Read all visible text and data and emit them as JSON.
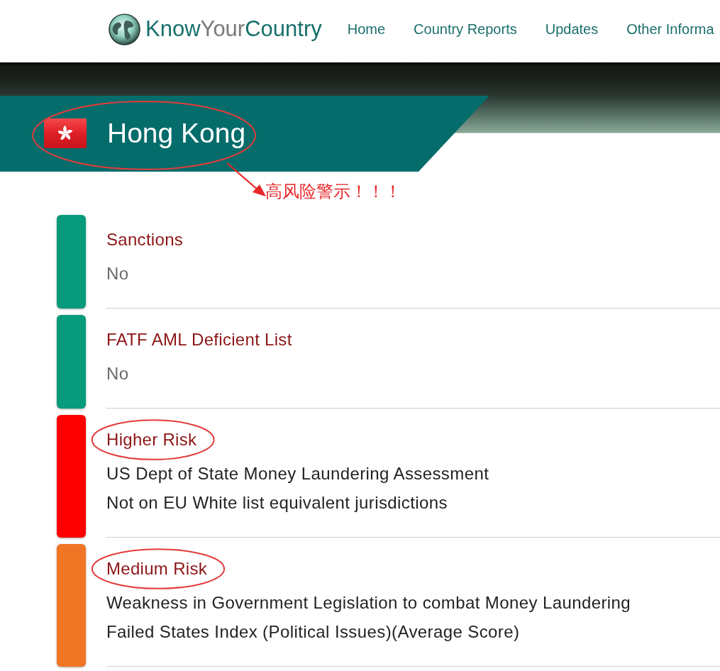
{
  "header": {
    "logo": [
      {
        "text": "Know",
        "kind": "brand"
      },
      {
        "text": "Your",
        "kind": "muted"
      },
      {
        "text": "Country",
        "kind": "brand"
      }
    ],
    "nav": [
      "Home",
      "Country Reports",
      "Updates",
      "Other Informa"
    ]
  },
  "banner": {
    "title": "Hong Kong",
    "circled": true
  },
  "callout": {
    "text": "高风险警示！！！"
  },
  "risk_sections": [
    {
      "title": "Sanctions",
      "kind": "status",
      "color": "#079a7b",
      "circled": false,
      "lines": [
        "No"
      ]
    },
    {
      "title": "FATF AML Deficient List",
      "kind": "status",
      "color": "#079a7b",
      "circled": false,
      "lines": [
        "No"
      ]
    },
    {
      "title": "Higher Risk",
      "kind": "findings",
      "color": "#ff0000",
      "circled": true,
      "lines": [
        "US Dept of State Money Laundering Assessment",
        "Not on EU White list equivalent jurisdictions"
      ]
    },
    {
      "title": "Medium Risk",
      "kind": "findings",
      "color": "#f07525",
      "circled": true,
      "lines": [
        "Weakness in Government Legislation to combat Money Laundering",
        "Failed States Index (Political Issues)(Average Score)"
      ]
    }
  ]
}
